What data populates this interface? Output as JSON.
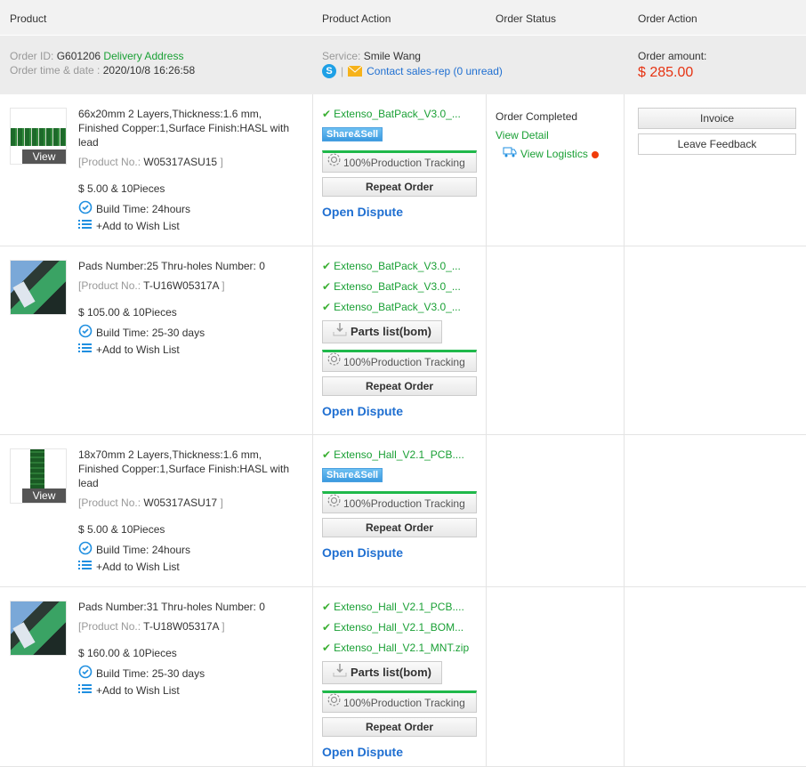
{
  "header": {
    "product": "Product",
    "product_action": "Product Action",
    "order_status": "Order Status",
    "order_action": "Order Action"
  },
  "order": {
    "id_label": "Order ID:",
    "id": "G601206",
    "delivery": "Delivery Address",
    "time_label": "Order time & date :",
    "time": "2020/10/8 16:26:58",
    "service_label": "Service:",
    "service": "Smile Wang",
    "contact": "Contact sales-rep (0 unread)",
    "separator": "|",
    "amount_label": "Order amount:",
    "amount": "$ 285.00",
    "amount_color": "#e63312"
  },
  "status": {
    "text": "Order Completed",
    "view_detail": "View Detail",
    "view_logistics": "View Logistics"
  },
  "order_actions": {
    "invoice": "Invoice",
    "feedback": "Leave Feedback"
  },
  "labels": {
    "view": "View",
    "product_no": "[Product No.:",
    "bracket": "]",
    "wish": "+Add to Wish List",
    "share": "Share&Sell",
    "tracking": "100%Production Tracking",
    "repeat": "Repeat Order",
    "dispute": "Open Dispute",
    "parts": "Parts list(bom)"
  },
  "products": [
    {
      "image": "pcb-wide",
      "desc": "66x20mm 2 Layers,Thickness:1.6 mm, Finished Copper:1,Surface Finish:HASL with lead",
      "product_no": "W05317ASU15",
      "price": "$ 5.00 & 10Pieces",
      "build": "Build Time: 24hours",
      "files": [
        "Extenso_BatPack_V3.0_..."
      ],
      "share": true,
      "parts": false,
      "tracking_pct": 100
    },
    {
      "image": "photo",
      "desc": "Pads Number:25 Thru-holes Number: 0",
      "product_no": "T-U16W05317A",
      "price": "$ 105.00 & 10Pieces",
      "build": "Build Time: 25-30 days",
      "files": [
        "Extenso_BatPack_V3.0_...",
        "Extenso_BatPack_V3.0_...",
        "Extenso_BatPack_V3.0_..."
      ],
      "share": false,
      "parts": true,
      "tracking_pct": 100
    },
    {
      "image": "pcb-tall",
      "desc": "18x70mm 2 Layers,Thickness:1.6 mm, Finished Copper:1,Surface Finish:HASL with lead",
      "product_no": "W05317ASU17",
      "price": "$ 5.00 & 10Pieces",
      "build": "Build Time: 24hours",
      "files": [
        "Extenso_Hall_V2.1_PCB...."
      ],
      "share": true,
      "parts": false,
      "tracking_pct": 100
    },
    {
      "image": "photo",
      "desc": "Pads Number:31 Thru-holes Number: 0",
      "product_no": "T-U18W05317A",
      "price": "$ 160.00 & 10Pieces",
      "build": "Build Time: 25-30 days",
      "files": [
        "Extenso_Hall_V2.1_PCB....",
        "Extenso_Hall_V2.1_BOM...",
        "Extenso_Hall_V2.1_MNT.zip"
      ],
      "share": false,
      "parts": true,
      "tracking_pct": 100
    }
  ]
}
